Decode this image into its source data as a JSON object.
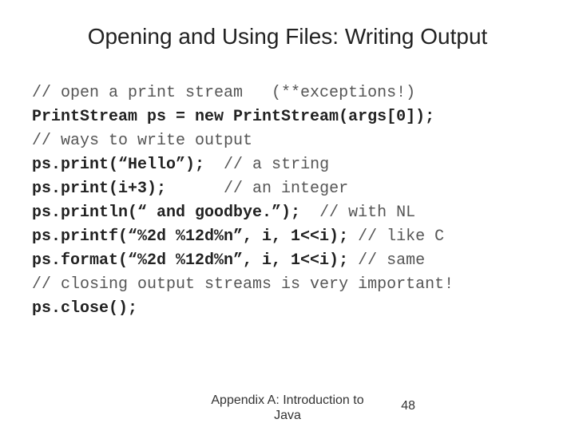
{
  "title": "Opening and Using Files: Writing Output",
  "lines": [
    {
      "code": "// open a print stream   (**exceptions!)",
      "bold": false
    },
    {
      "code": "PrintStream ps = new PrintStream(args[0]);",
      "bold": true
    },
    {
      "code": "// ways to write output",
      "bold": false
    },
    {
      "code": "ps.print(“Hello”);",
      "comment": "  // a string",
      "bold": true
    },
    {
      "code": "ps.print(i+3);",
      "comment": "      // an integer",
      "bold": true
    },
    {
      "code": "ps.println(“ and goodbye.”);",
      "comment": "  // with NL",
      "bold": true
    },
    {
      "code": "ps.printf(“%2d %12d%n”, i, 1<<i);",
      "comment": " // like C",
      "bold": true
    },
    {
      "code": "ps.format(“%2d %12d%n”, i, 1<<i);",
      "comment": " // same",
      "bold": true
    },
    {
      "code": "// closing output streams is very important!",
      "bold": false
    },
    {
      "code": "ps.close();",
      "bold": true
    }
  ],
  "footer": "Appendix A: Introduction to Java",
  "page": "48"
}
